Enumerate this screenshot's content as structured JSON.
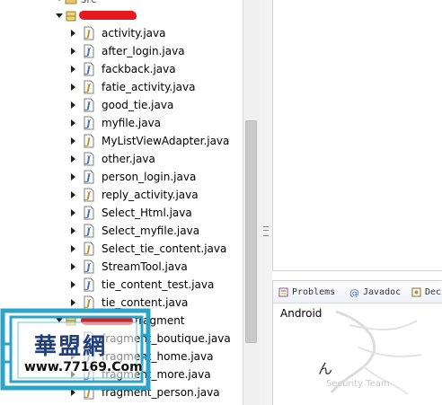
{
  "package_explorer": {
    "root_label": "src",
    "package_name_redacted": "",
    "files": [
      "activity.java",
      "after_login.java",
      "fackback.java",
      "fatie_activity.java",
      "good_tie.java",
      "myfile.java",
      "MyListViewAdapter.java",
      "other.java",
      "person_login.java",
      "reply_activity.java",
      "Select_Html.java",
      "Select_myfile.java",
      "Select_tie_content.java",
      "StreamTool.java",
      "tie_content_test.java",
      "tie_content.java"
    ],
    "fragment_package_label": "fragment",
    "fragment_files": [
      "fragment_boutique.java",
      "fragment_home.java",
      "fragment_more.java",
      "fragment_person.java"
    ]
  },
  "bottom_panel": {
    "tabs": [
      {
        "label": "Problems",
        "icon": "problems-icon"
      },
      {
        "label": "Javadoc",
        "icon": "javadoc-icon"
      },
      {
        "label": "Dec",
        "icon": "declaration-icon"
      }
    ],
    "content_text": "Android",
    "watermark_text": "Security Team",
    "watermark_glyph": "ん"
  },
  "overlay_stamp": {
    "title": "華盟網",
    "url": "www.77169.Com"
  },
  "colors": {
    "redaction": "#e8191e",
    "stamp_border": "#2aa5c9",
    "stamp_title": "#1f3e7c",
    "java_icon_blue": "#3f6fb6",
    "java_icon_brown": "#c08a2f"
  }
}
